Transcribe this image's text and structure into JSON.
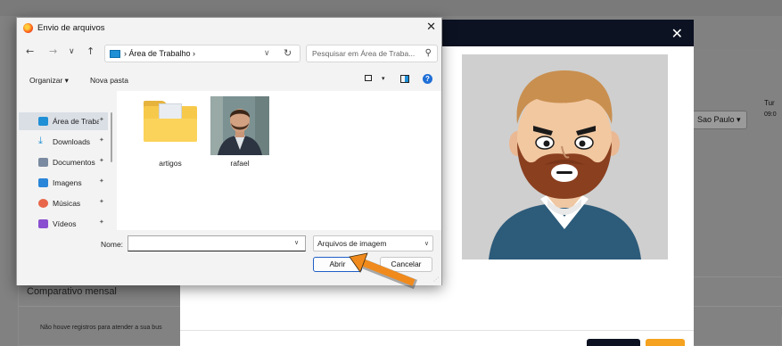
{
  "background": {
    "select_value": "Sao Paulo",
    "turno_label": "Tur",
    "time_value": "09:0",
    "section_title": "Comparativo mensal",
    "empty_message": "Não houve registros para atender a sua bus"
  },
  "modal": {
    "close_label": "✕",
    "header_color": "#0c1222",
    "accent_color": "#f4a21f"
  },
  "dialog": {
    "title": "Envio de arquivos",
    "close_label": "✕",
    "nav": {
      "back": "←",
      "forward": "→",
      "recent": "∨",
      "up": "↑"
    },
    "address": "›  Área de Trabalho  ›",
    "address_chevron": "∨",
    "refresh": "↻",
    "search_placeholder": "Pesquisar em Área de Traba...",
    "toolbar": {
      "organize": "Organizar ▾",
      "new_folder": "Nova pasta",
      "view_chevron": "▾",
      "help": "?"
    },
    "sidebar": [
      {
        "label": "Área de Traba",
        "icon": "desktop-icon",
        "color": "#1f8fd6",
        "active": true
      },
      {
        "label": "Downloads",
        "icon": "download-icon",
        "color": "#1f8fd6",
        "active": false
      },
      {
        "label": "Documentos",
        "icon": "documents-icon",
        "color": "#7a8aa0",
        "active": false
      },
      {
        "label": "Imagens",
        "icon": "images-icon",
        "color": "#2a86d8",
        "active": false
      },
      {
        "label": "Músicas",
        "icon": "music-icon",
        "color": "#e8674a",
        "active": false
      },
      {
        "label": "Vídeos",
        "icon": "videos-icon",
        "color": "#8a4fd0",
        "active": false
      }
    ],
    "pin_glyph": "📌",
    "files": [
      {
        "name": "artigos",
        "type": "folder"
      },
      {
        "name": "rafael",
        "type": "image"
      }
    ],
    "name_label": "Nome:",
    "name_value": "",
    "name_chevron": "∨",
    "file_type": "Arquivos de imagem",
    "file_type_chevron": "∨",
    "open_label": "Abrir",
    "cancel_label": "Cancelar"
  }
}
